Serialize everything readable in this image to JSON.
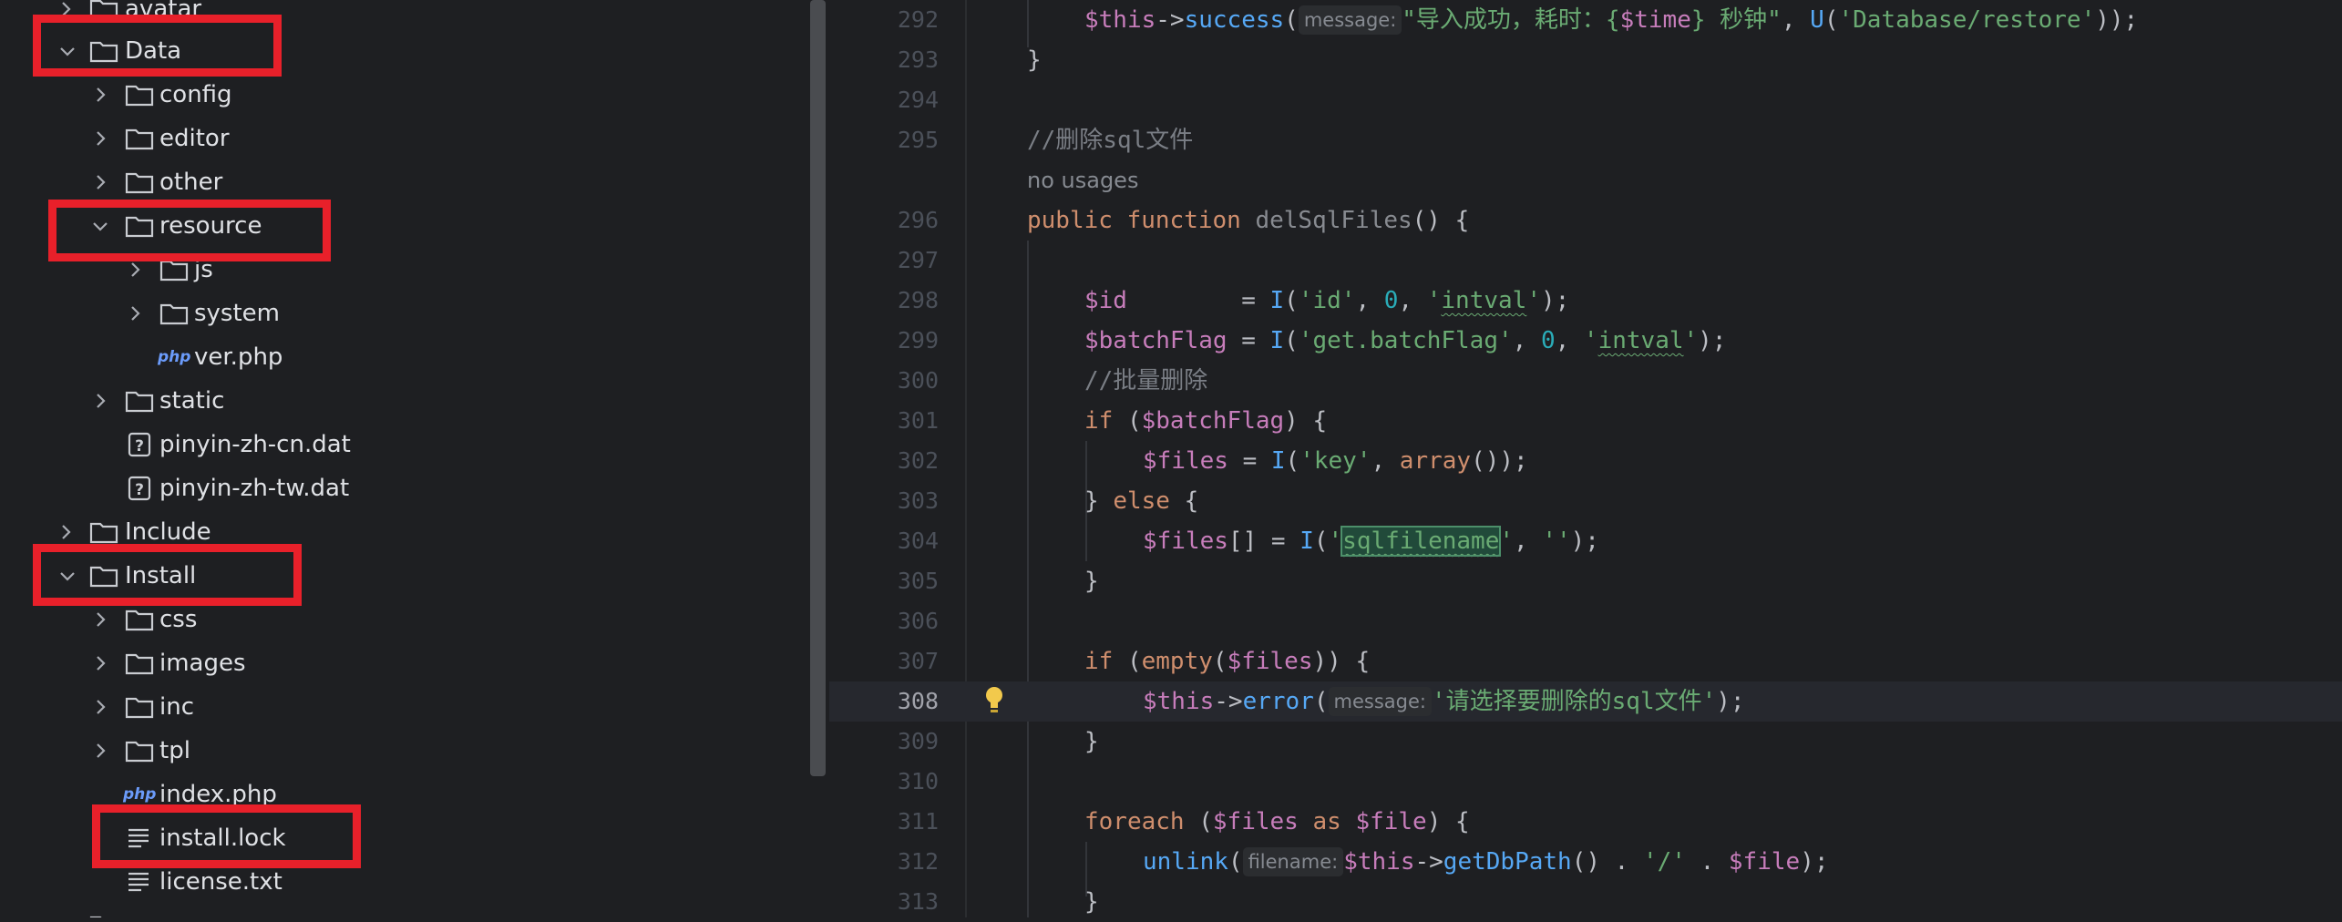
{
  "project_tree": {
    "items": [
      {
        "label": "avatar",
        "type": "folder",
        "expanded": false
      },
      {
        "label": "Data",
        "type": "folder",
        "expanded": true
      },
      {
        "label": "config",
        "type": "folder",
        "expanded": false
      },
      {
        "label": "editor",
        "type": "folder",
        "expanded": false
      },
      {
        "label": "other",
        "type": "folder",
        "expanded": false
      },
      {
        "label": "resource",
        "type": "folder",
        "expanded": true
      },
      {
        "label": "js",
        "type": "folder",
        "expanded": false
      },
      {
        "label": "system",
        "type": "folder",
        "expanded": false
      },
      {
        "label": "ver.php",
        "type": "php-file",
        "icon_text": "php"
      },
      {
        "label": "static",
        "type": "folder",
        "expanded": false
      },
      {
        "label": "pinyin-zh-cn.dat",
        "type": "unknown-file"
      },
      {
        "label": "pinyin-zh-tw.dat",
        "type": "unknown-file"
      },
      {
        "label": "Include",
        "type": "folder",
        "expanded": false
      },
      {
        "label": "Install",
        "type": "folder",
        "expanded": true
      },
      {
        "label": "css",
        "type": "folder",
        "expanded": false
      },
      {
        "label": "images",
        "type": "folder",
        "expanded": false
      },
      {
        "label": "inc",
        "type": "folder",
        "expanded": false
      },
      {
        "label": "tpl",
        "type": "folder",
        "expanded": false
      },
      {
        "label": "index.php",
        "type": "php-file",
        "icon_text": "php"
      },
      {
        "label": "install.lock",
        "type": "text-file"
      },
      {
        "label": "license.txt",
        "type": "text-file"
      }
    ]
  },
  "editor": {
    "no_usages_label": "no usages",
    "hints": {
      "message": "message:",
      "filename": "filename:"
    },
    "lines": [
      {
        "n": "292",
        "t": {
          "a": "$this",
          "b": "->",
          "c": "success",
          "d": "(",
          "e": "\"导入成功，耗时：{",
          "f": "$time",
          "g": "} 秒钟\"",
          "h": ", ",
          "i": "U",
          "j": "(",
          "k": "'Database/restore'",
          "l": "));"
        }
      },
      {
        "n": "293",
        "t": {
          "a": "}"
        }
      },
      {
        "n": "294",
        "t": {}
      },
      {
        "n": "295",
        "t": {
          "a": "//删除sql文件"
        }
      },
      {
        "n": "296",
        "t": {
          "a": "public",
          "b": "function",
          "c": "delSqlFiles",
          "d": "() {"
        }
      },
      {
        "n": "297",
        "t": {}
      },
      {
        "n": "298",
        "t": {
          "a": "$id",
          "b": "        = ",
          "c": "I",
          "d": "(",
          "e": "'id'",
          "f": ", ",
          "g": "0",
          "h": ", ",
          "i": "'",
          "j": "intval",
          "k": "'",
          "l": ");"
        }
      },
      {
        "n": "299",
        "t": {
          "a": "$batchFlag",
          "b": " = ",
          "c": "I",
          "d": "(",
          "e": "'get.batchFlag'",
          "f": ", ",
          "g": "0",
          "h": ", ",
          "i": "'",
          "j": "intval",
          "k": "'",
          "l": ");"
        }
      },
      {
        "n": "300",
        "t": {
          "a": "//批量删除"
        }
      },
      {
        "n": "301",
        "t": {
          "a": "if",
          "b": " (",
          "c": "$batchFlag",
          "d": ") {"
        }
      },
      {
        "n": "302",
        "t": {
          "a": "$files",
          "b": " = ",
          "c": "I",
          "d": "(",
          "e": "'key'",
          "f": ", ",
          "g": "array",
          "h": "());"
        }
      },
      {
        "n": "303",
        "t": {
          "a": "} ",
          "b": "else",
          "c": " {"
        }
      },
      {
        "n": "304",
        "t": {
          "a": "$files",
          "b": "[] = ",
          "c": "I",
          "d": "(",
          "e": "'",
          "f": "sqlfilename",
          "g": "'",
          "h": ", ",
          "i": "''",
          "j": ");"
        }
      },
      {
        "n": "305",
        "t": {
          "a": "}"
        }
      },
      {
        "n": "306",
        "t": {}
      },
      {
        "n": "307",
        "t": {
          "a": "if",
          "b": " (",
          "c": "empty",
          "d": "(",
          "e": "$files",
          "f": ")) {"
        }
      },
      {
        "n": "308",
        "t": {
          "a": "$this",
          "b": "->",
          "c": "error",
          "d": "(",
          "e": "'请选择要删除的sql文件'",
          "f": ");"
        }
      },
      {
        "n": "309",
        "t": {
          "a": "}"
        }
      },
      {
        "n": "310",
        "t": {}
      },
      {
        "n": "311",
        "t": {
          "a": "foreach",
          "b": " (",
          "c": "$files",
          "d": " as ",
          "e": "$file",
          "f": ") {"
        }
      },
      {
        "n": "312",
        "t": {
          "a": "unlink",
          "b": "(",
          "c": "$this",
          "d": "->",
          "e": "getDbPath",
          "f": "() . ",
          "g": "'/'",
          "h": " . ",
          "i": "$file",
          "j": ");"
        }
      },
      {
        "n": "313",
        "t": {
          "a": "}"
        }
      }
    ]
  },
  "colors": {
    "annotation_red": "#e8202a",
    "folder_icon": "#c9ccd1",
    "php_icon": "#6b9bfa",
    "bulb": "#f2c94c"
  }
}
